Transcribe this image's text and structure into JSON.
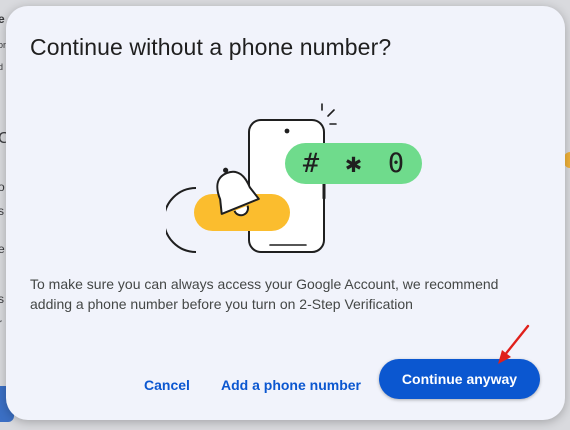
{
  "background": {
    "fragments": [
      "e",
      "or",
      "d",
      "C",
      "o",
      "s",
      "e",
      "s",
      "r"
    ]
  },
  "dialog": {
    "title": "Continue without a phone number?",
    "illustration": {
      "keypad_symbols": "# ✱ 0"
    },
    "body": "To make sure you can always access your Google Account, we recommend adding a phone number before you turn on 2-Step Verification",
    "buttons": {
      "cancel": "Cancel",
      "add_phone": "Add a phone number",
      "continue": "Continue anyway"
    }
  },
  "colors": {
    "primary": "#0b57d0",
    "dialog_bg": "#f1f3fb",
    "pill_green": "#6fdb8c",
    "pill_yellow": "#fbbd2e",
    "annotation_arrow": "#e0201b"
  }
}
